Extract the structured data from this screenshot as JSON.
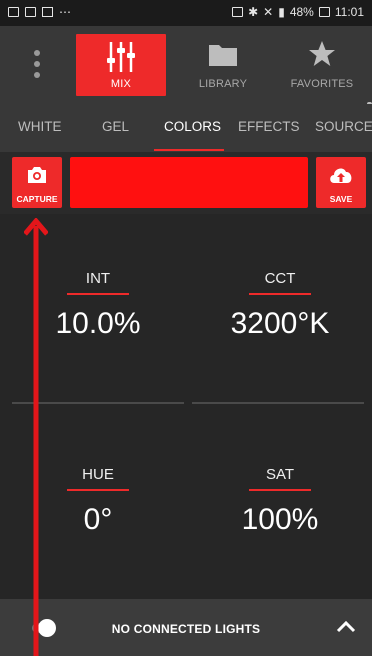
{
  "status_bar": {
    "more": "⋯",
    "battery": "48%",
    "time": "11:01"
  },
  "nav": {
    "mix_label": "MIX",
    "library_label": "LIBRARY",
    "favorites_label": "FAVORITES",
    "icons": [
      "kebab-menu-icon",
      "sliders-icon",
      "folder-icon",
      "star-icon"
    ]
  },
  "tabs": [
    {
      "label": "WHITE"
    },
    {
      "label": "GEL"
    },
    {
      "label": "COLORS",
      "active": true
    },
    {
      "label": "EFFECTS"
    },
    {
      "label": "SOURCE"
    }
  ],
  "actions": {
    "capture_label": "CAPTURE",
    "save_label": "SAVE",
    "swatch_color": "#ff1010"
  },
  "params": {
    "int": {
      "label": "INT",
      "value": "10.0%"
    },
    "cct": {
      "label": "CCT",
      "value": "3200°K"
    },
    "hue": {
      "label": "HUE",
      "value": "0°"
    },
    "sat": {
      "label": "SAT",
      "value": "100%"
    }
  },
  "bottom": {
    "status": "NO CONNECTED LIGHTS"
  },
  "colors": {
    "accent": "#ee2a2a",
    "background": "#262626",
    "bar": "#383838"
  }
}
